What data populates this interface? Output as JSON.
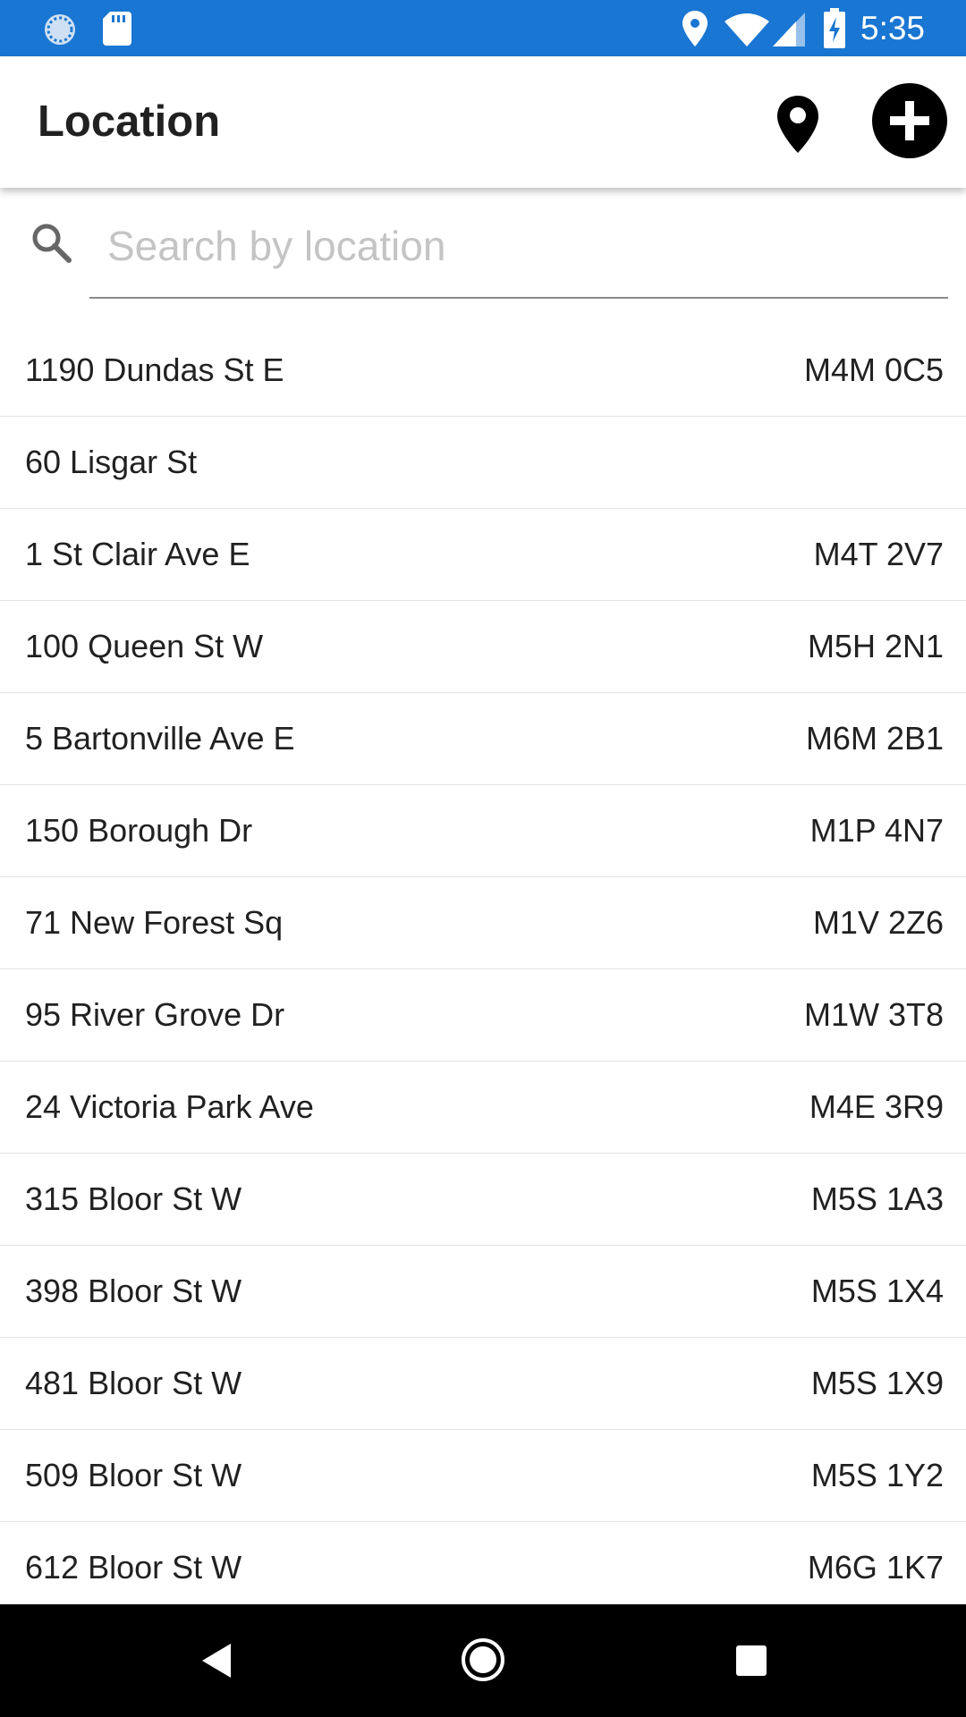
{
  "status_bar": {
    "time": "5:35",
    "left_icons": [
      "sync-icon",
      "sd-card-icon"
    ],
    "right_icons": [
      "location-icon",
      "wifi-icon",
      "signal-icon",
      "battery-charging-icon"
    ],
    "color": "#1976d2"
  },
  "header": {
    "title": "Location",
    "actions": [
      "map-pin-icon",
      "add-circle-icon"
    ]
  },
  "search": {
    "placeholder": "Search by location",
    "value": ""
  },
  "locations": [
    {
      "address": "1190 Dundas St E",
      "postal": "M4M 0C5"
    },
    {
      "address": "60 Lisgar St",
      "postal": ""
    },
    {
      "address": "1 St Clair Ave E",
      "postal": "M4T 2V7"
    },
    {
      "address": "100 Queen St W",
      "postal": "M5H 2N1"
    },
    {
      "address": "5 Bartonville Ave E",
      "postal": "M6M 2B1"
    },
    {
      "address": "150 Borough Dr",
      "postal": "M1P 4N7"
    },
    {
      "address": "71 New Forest Sq",
      "postal": "M1V 2Z6"
    },
    {
      "address": "95 River Grove Dr",
      "postal": "M1W 3T8"
    },
    {
      "address": "24 Victoria Park Ave",
      "postal": "M4E 3R9"
    },
    {
      "address": "315 Bloor St W",
      "postal": "M5S 1A3"
    },
    {
      "address": "398 Bloor St W",
      "postal": "M5S 1X4"
    },
    {
      "address": "481 Bloor St W",
      "postal": "M5S 1X9"
    },
    {
      "address": "509 Bloor St W",
      "postal": "M5S 1Y2"
    },
    {
      "address": "612 Bloor St W",
      "postal": "M6G 1K7"
    }
  ],
  "nav_bar": {
    "buttons": [
      "back-icon",
      "home-icon",
      "recents-icon"
    ]
  }
}
